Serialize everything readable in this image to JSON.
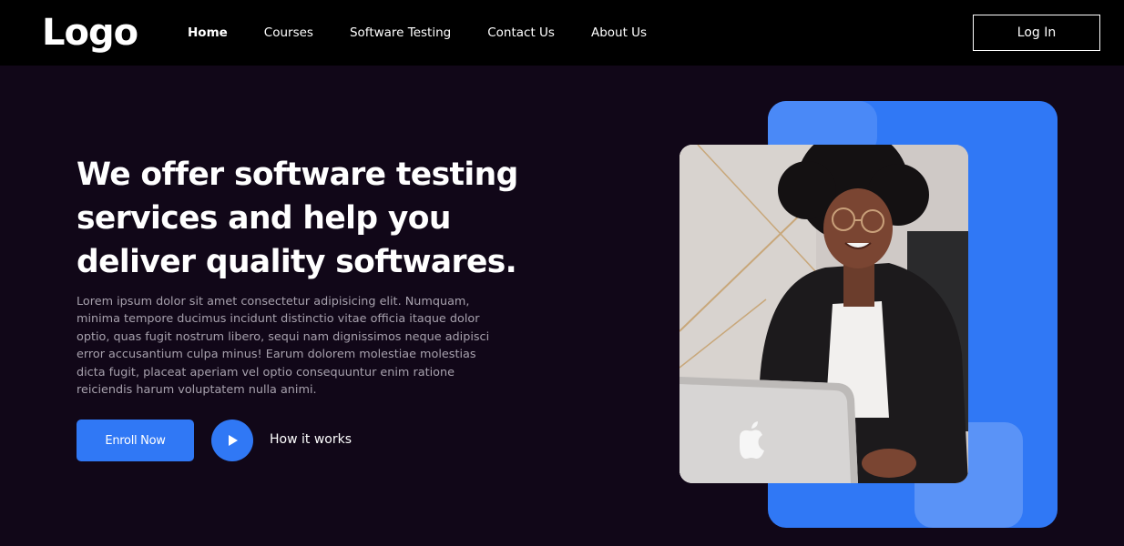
{
  "header": {
    "logo": "Logo",
    "nav": [
      {
        "label": "Home",
        "active": true
      },
      {
        "label": "Courses"
      },
      {
        "label": "Software Testing"
      },
      {
        "label": "Contact Us"
      },
      {
        "label": "About Us"
      }
    ],
    "login_label": "Log In"
  },
  "hero": {
    "title_lines": [
      "We offer software testing",
      "services and help you",
      "deliver quality softwares."
    ],
    "description": "Lorem ipsum dolor sit amet consectetur adipisicing elit. Numquam, minima tempore ducimus incidunt distinctio vitae officia itaque dolor optio, quas fugit nostrum libero, sequi nam dignissimos neque adipisci error accusantium culpa minus! Earum dolorem molestiae molestias dicta fugit, placeat aperiam vel optio consequuntur enim ratione reiciendis harum voluptatem nulla animi.",
    "enroll_label": "Enroll Now",
    "how_label": "How it works",
    "play_icon": "play-icon"
  },
  "colors": {
    "background": "#110718",
    "header": "#000000",
    "accent": "#3078f5",
    "text_muted": "#a7a1ad"
  }
}
